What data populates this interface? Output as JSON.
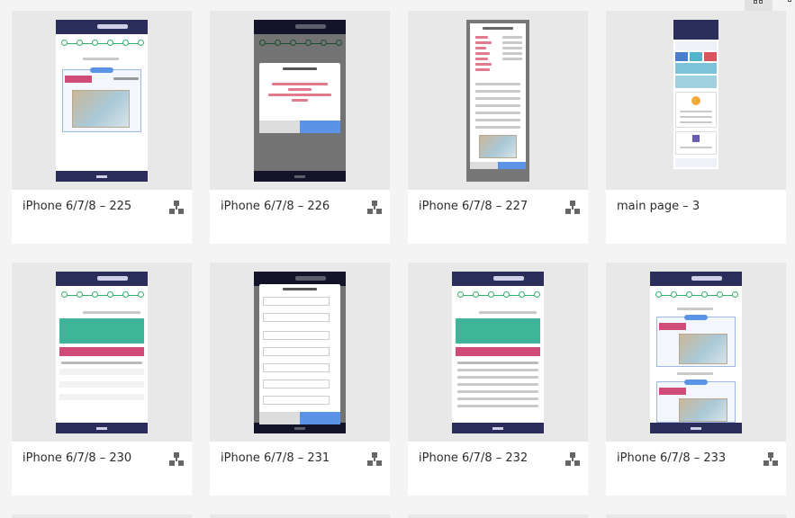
{
  "cards": [
    {
      "title": "iPhone 6/7/8 – 225"
    },
    {
      "title": "iPhone 6/7/8 – 226"
    },
    {
      "title": "iPhone 6/7/8 – 227"
    },
    {
      "title": "main page – 3"
    },
    {
      "title": "iPhone 6/7/8 – 230"
    },
    {
      "title": "iPhone 6/7/8 – 231"
    },
    {
      "title": "iPhone 6/7/8 – 232"
    },
    {
      "title": "iPhone 6/7/8 – 233"
    }
  ],
  "icons": {
    "prototype": "prototype-flow-icon",
    "view_toggle": "grid-view-icon"
  },
  "colors": {
    "header": "#2b2d5b",
    "accent_green": "#35b06b",
    "accent_pink": "#d14b78",
    "accent_blue": "#5b93e6",
    "teal": "#3fb59a"
  }
}
